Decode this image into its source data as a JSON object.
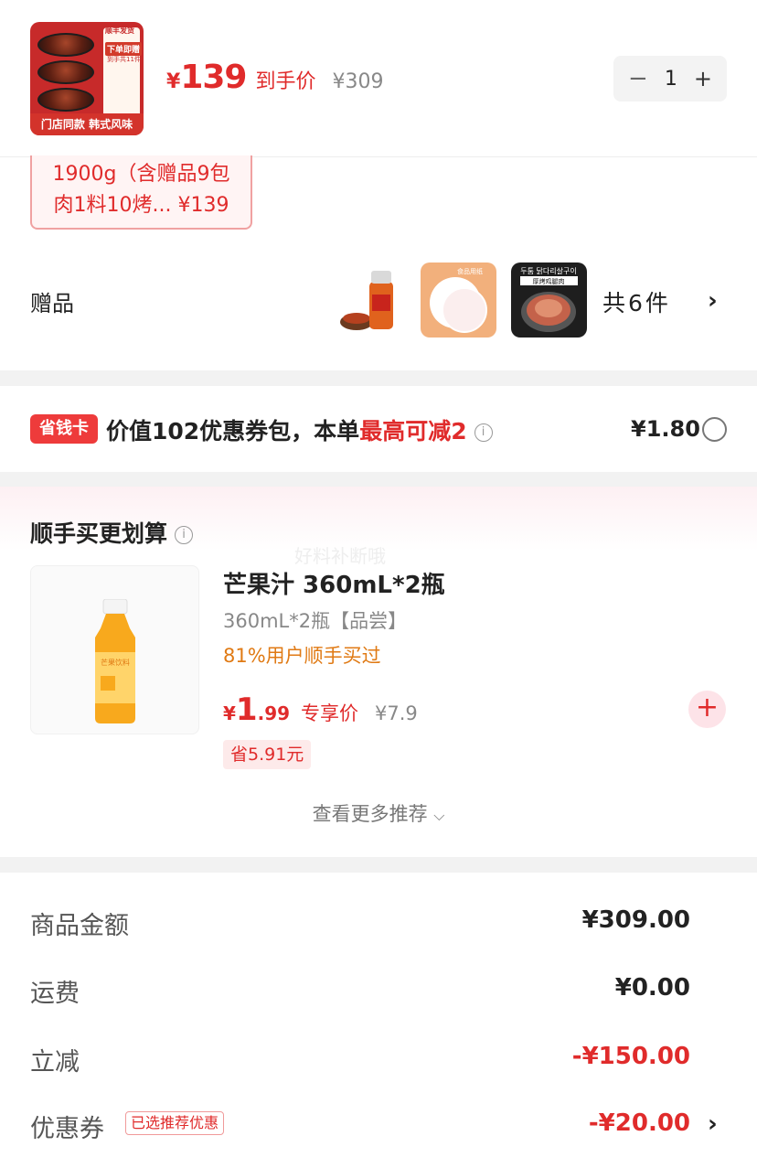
{
  "product": {
    "thumb_badge": "顺丰发货",
    "thumb_promo": "下单即赠",
    "thumb_promo_sub": "到手共11件",
    "thumb_footer": "门店同款 韩式风味",
    "currency": "¥",
    "price": "139",
    "price_tag": "到手价",
    "original_price": "¥309",
    "quantity": "1",
    "spec_line1": "1900g（含赠品9包",
    "spec_line2": "肉1料10烤... ¥139"
  },
  "gifts": {
    "label": "赠品",
    "count": "共6件",
    "items": [
      {
        "icon": "seasoning-jar-icon"
      },
      {
        "icon": "baking-paper-icon",
        "text": "食品用纸"
      },
      {
        "icon": "korean-chicken-pack-icon",
        "text": "두툼 닭다리살구이",
        "subtext": "厚烤鸡腿肉"
      }
    ]
  },
  "savings": {
    "badge": "省钱卡",
    "text_prefix": "价值102优惠券包，本单",
    "text_highlight": "最高可减2",
    "price": "¥1.80"
  },
  "recommend": {
    "title": "顺手买更划算",
    "watermark": "好料补断哦",
    "product": {
      "name": "芒果汁 360mL*2瓶",
      "spec": "360mL*2瓶【品尝】",
      "stat": "81%用户顺手买过",
      "currency": "¥",
      "price_int": "1",
      "price_dec": ".99",
      "price_tag": "专享价",
      "original_price": "¥7.9",
      "save": "省5.91元",
      "bottle_label": "芒果饮料"
    },
    "more": "查看更多推荐"
  },
  "summary": {
    "rows": [
      {
        "label": "商品金额",
        "value": "¥309.00"
      },
      {
        "label": "运费",
        "value": "¥0.00"
      },
      {
        "label": "立减",
        "value": "-¥150.00"
      },
      {
        "label": "优惠券",
        "value": "-¥20.00",
        "tag": "已选推荐优惠"
      }
    ]
  },
  "colors": {
    "accent_red": "#e02b2b",
    "orange": "#e07a14"
  }
}
